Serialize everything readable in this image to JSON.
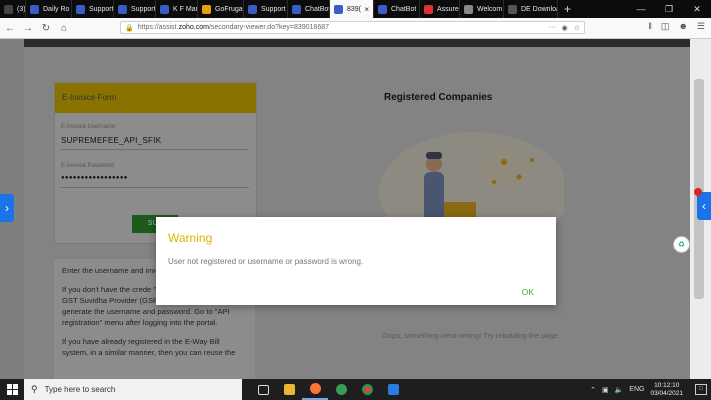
{
  "tabs": [
    {
      "label": "(3) -",
      "color": "#444",
      "active": false
    },
    {
      "label": "Daily Ro",
      "color": "#3b5cc4",
      "active": false
    },
    {
      "label": "Support",
      "color": "#3b5cc4",
      "active": false
    },
    {
      "label": "Support",
      "color": "#3b5cc4",
      "active": false
    },
    {
      "label": "K F Mar",
      "color": "#3b5cc4",
      "active": false
    },
    {
      "label": "GoFrugal",
      "color": "#e6a200",
      "active": false
    },
    {
      "label": "Support",
      "color": "#3b5cc4",
      "active": false
    },
    {
      "label": "ChatBot",
      "color": "#3b5cc4",
      "active": false
    },
    {
      "label": "839(",
      "color": "#3b5cc4",
      "active": true
    },
    {
      "label": "ChatBot",
      "color": "#3b5cc4",
      "active": false
    },
    {
      "label": "Assure",
      "color": "#d33",
      "active": false
    },
    {
      "label": "Welcom",
      "color": "#888",
      "active": false
    },
    {
      "label": "DE Download",
      "color": "#555",
      "active": false
    }
  ],
  "url": {
    "prefix": "https://assist.",
    "domain": "zoho.com",
    "path": "/secondary-viewer.do?key=839018687",
    "dots": "···"
  },
  "form": {
    "title": "E-Invoice Form",
    "username_label": "E-Invoice Username",
    "username_value": "SUPREMEFEE_API_SFIK",
    "password_label": "E-Invoice Password",
    "password_value": "●●●●●●●●●●●●●●●●●",
    "submit_label": "SUB"
  },
  "info": {
    "p1": "Enter the username and invoice portal against GSP.",
    "p2": "If you don't have the crede \"Zoho Corporation\" as your GST Suvidha Provider (GSP) in the e-invoice portal to generate the username and password. Go to \"API registration\" menu after logging into the portal.",
    "p3": "If you have already registered in the E-Way Bill system, in a similar manner, then you can reuse the"
  },
  "registered_title": "Registered Companies",
  "oops_text": "Oops, something went wrong! Try reloading the page.",
  "modal": {
    "title": "Warning",
    "message": "User not registered or username or password is wrong.",
    "ok_label": "OK",
    "title_color": "#e2b200",
    "ok_color": "#3cb04a"
  },
  "taskbar": {
    "search_placeholder": "Type here to search",
    "language": "ENG",
    "time": "10:12:10",
    "date": "03/04/2021"
  }
}
